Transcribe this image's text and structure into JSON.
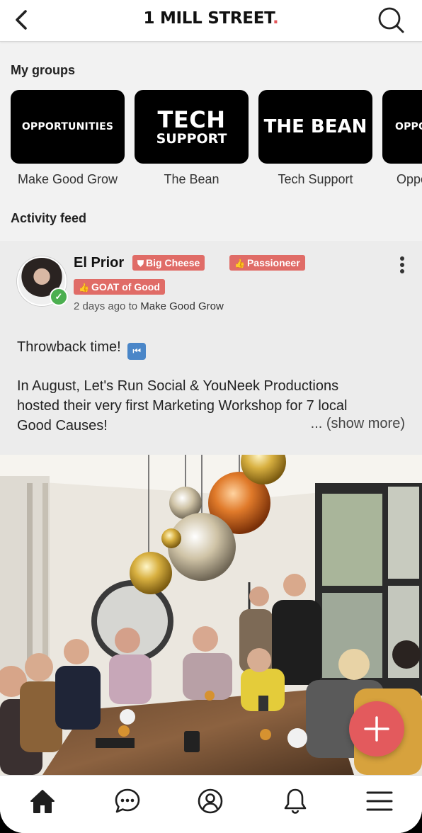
{
  "header": {
    "title_main": "1 MILL STREET",
    "title_dot": ".",
    "back_icon": "chevron-left-icon",
    "search_icon": "search-icon"
  },
  "groups_section": {
    "title": "My groups",
    "items": [
      {
        "tile_text": "OPPORTUNITIES",
        "label": "Make Good Grow"
      },
      {
        "tile_line1": "TECH",
        "tile_line2": "SUPPORT",
        "label": "The Bean"
      },
      {
        "tile_text": "THE BEAN",
        "label": "Tech Support"
      },
      {
        "tile_text": "OPPORTUNITIES",
        "label": "Opportunities"
      }
    ]
  },
  "feed": {
    "title": "Activity feed",
    "post": {
      "author": "El Prior",
      "badges": [
        {
          "icon": "shield-icon",
          "label": "Big Cheese"
        },
        {
          "icon": "thumbs-up-icon",
          "label": "Passioneer"
        },
        {
          "icon": "thumbs-up-icon",
          "label": "GOAT of Good"
        }
      ],
      "time": "2 days ago",
      "to_word": "to",
      "group": "Make Good Grow",
      "line1": "Throwback time!",
      "body_lines": [
        "In August, Let's Run Social & YouNeek Productions",
        "hosted their very first Marketing Workshop for 7 local",
        "Good Causes!"
      ],
      "show_more": "... (show more)"
    }
  },
  "tabbar": {
    "items": [
      "home-icon",
      "chat-icon",
      "profile-icon",
      "bell-icon",
      "menu-icon"
    ]
  },
  "colors": {
    "accent": "#e35a5d",
    "badge": "#e06c67",
    "verified": "#4caf50"
  }
}
